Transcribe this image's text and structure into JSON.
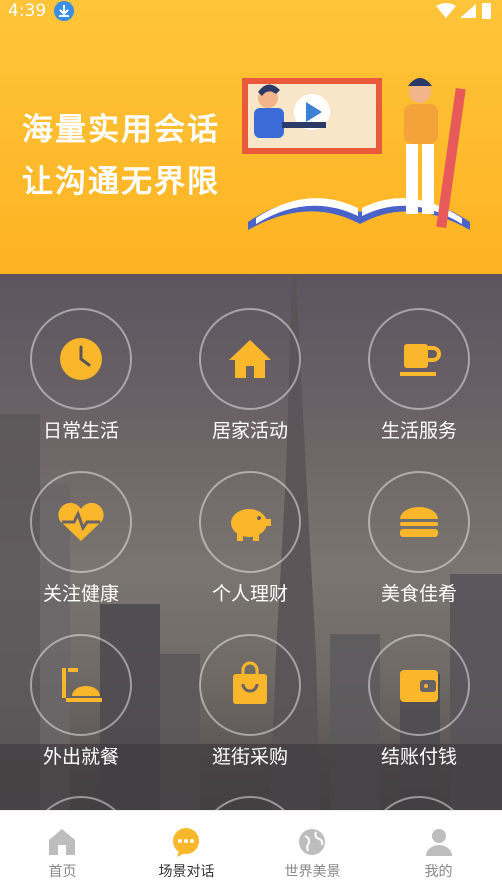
{
  "status": {
    "time": "4:39"
  },
  "banner": {
    "line1": "海量实用会话",
    "line2": "让沟通无界限"
  },
  "categories": [
    {
      "label": "日常生活",
      "icon": "clock-icon"
    },
    {
      "label": "居家活动",
      "icon": "home-icon"
    },
    {
      "label": "生活服务",
      "icon": "coffee-cup-icon"
    },
    {
      "label": "关注健康",
      "icon": "heartbeat-icon"
    },
    {
      "label": "个人理财",
      "icon": "piggy-bank-icon"
    },
    {
      "label": "美食佳肴",
      "icon": "burger-icon"
    },
    {
      "label": "外出就餐",
      "icon": "dining-icon"
    },
    {
      "label": "逛街采购",
      "icon": "shopping-bag-icon"
    },
    {
      "label": "结账付钱",
      "icon": "wallet-icon"
    }
  ],
  "tabs": [
    {
      "label": "首页",
      "icon": "home-tab-icon",
      "active": false
    },
    {
      "label": "场景对话",
      "icon": "chat-bubble-icon",
      "active": true
    },
    {
      "label": "世界美景",
      "icon": "globe-icon",
      "active": false
    },
    {
      "label": "我的",
      "icon": "user-icon",
      "active": false
    }
  ],
  "colors": {
    "accent": "#fbb72b",
    "banner": "#ffc43a",
    "tab_inactive": "#888888"
  }
}
